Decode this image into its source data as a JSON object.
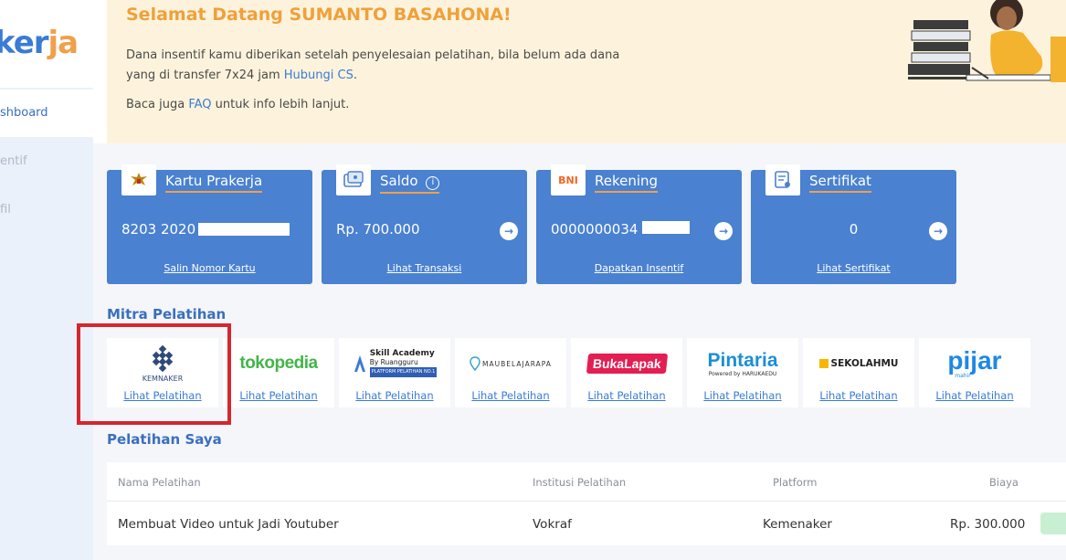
{
  "sidebar": {
    "logo": {
      "main": "ker",
      "accent": "ja"
    },
    "items": [
      {
        "label": "shboard",
        "active": true
      },
      {
        "label": "entif",
        "active": false
      },
      {
        "label": "fil",
        "active": false
      }
    ]
  },
  "banner": {
    "title": "Selamat Datang SUMANTO BASAHONA!",
    "text_line1": "Dana insentif kamu diberikan setelah penyelesaian pelatihan, bila belum ada dana",
    "text_line2_pre": "yang di transfer 7x24 jam ",
    "text_line2_link": "Hubungi CS",
    "text_line2_post": ".",
    "text3_pre": "Baca juga ",
    "text3_link": "FAQ",
    "text3_post": " untuk info lebih lanjut."
  },
  "cards": [
    {
      "title": "Kartu Prakerja",
      "value": "8203 2020 45",
      "link": "Salin Nomor Kartu",
      "icon": "garuda-icon",
      "arrow": false
    },
    {
      "title": "Saldo",
      "value": "Rp. 700.000",
      "link": "Lihat Transaksi",
      "icon": "wallet-icon",
      "arrow": true
    },
    {
      "title": "Rekening",
      "value": "0000000034",
      "link": "Dapatkan Insentif",
      "icon": "bni-icon",
      "icon_text": "BNI",
      "arrow": true
    },
    {
      "title": "Sertifikat",
      "value": "0",
      "link": "Lihat Sertifikat",
      "icon": "certificate-icon",
      "arrow": true
    }
  ],
  "mitra": {
    "title": "Mitra Pelatihan",
    "partners": [
      {
        "name": "KEMNAKER",
        "link": "Lihat Pelatihan"
      },
      {
        "name": "tokopedia",
        "link": "Lihat Pelatihan"
      },
      {
        "name": "Skill Academy",
        "sub": "By Ruangguru",
        "tag": "PLATFORM PELATIHAN NO.1",
        "link": "Lihat Pelatihan"
      },
      {
        "name": "MAUBELAJARAPA",
        "link": "Lihat Pelatihan"
      },
      {
        "name": "BukaLapak",
        "link": "Lihat Pelatihan"
      },
      {
        "name": "Pintaria",
        "sub": "Powered by HARUKAEDU",
        "link": "Lihat Pelatihan"
      },
      {
        "name": "SEKOLAHMU",
        "link": "Lihat Pelatihan"
      },
      {
        "name": "pijar",
        "sub": "mahir",
        "link": "Lihat Pelatihan"
      }
    ]
  },
  "pelatihan": {
    "title": "Pelatihan Saya",
    "headers": {
      "nama": "Nama Pelatihan",
      "institusi": "Institusi Pelatihan",
      "platform": "Platform",
      "biaya": "Biaya"
    },
    "rows": [
      {
        "nama": "Membuat Video untuk Jadi Youtuber",
        "institusi": "Vokraf",
        "platform": "Kemenaker",
        "biaya": "Rp. 300.000"
      }
    ]
  },
  "colors": {
    "primary": "#4a81d0",
    "accent": "#f0a04b",
    "highlight": "#d6262e"
  }
}
